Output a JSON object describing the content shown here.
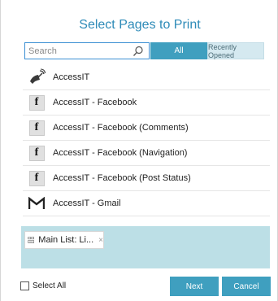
{
  "dialog": {
    "title": "Select Pages to Print"
  },
  "search": {
    "placeholder": "Search",
    "value": ""
  },
  "tabs": {
    "all_label": "All",
    "recent_label": "Recently Opened"
  },
  "pages": [
    {
      "label": "AccessIT",
      "icon": "broadcast-dish-icon"
    },
    {
      "label": "AccessIT - Facebook",
      "icon": "facebook-icon"
    },
    {
      "label": "AccessIT - Facebook (Comments)",
      "icon": "facebook-icon"
    },
    {
      "label": "AccessIT - Facebook (Navigation)",
      "icon": "facebook-icon"
    },
    {
      "label": "AccessIT - Facebook (Post Status)",
      "icon": "facebook-icon"
    },
    {
      "label": "AccessIT - Gmail",
      "icon": "gmail-icon"
    },
    {
      "label": "",
      "icon": "gmail-icon"
    }
  ],
  "selected": {
    "chip_label": "Main List: Li...",
    "chip_icon": "list-icon",
    "remove_glyph": "×"
  },
  "footer": {
    "select_all_label": "Select All",
    "select_all_checked": false,
    "next_label": "Next",
    "cancel_label": "Cancel"
  },
  "colors": {
    "accent": "#3f9fbf",
    "title": "#2e8bb8",
    "selected_area": "#bcdfe6",
    "recent_tab": "#d5e9f0"
  }
}
